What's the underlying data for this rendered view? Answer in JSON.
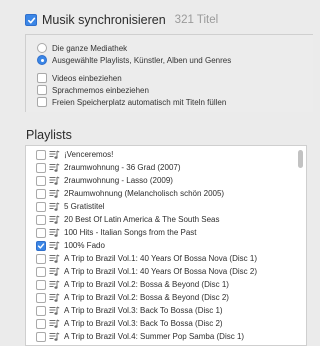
{
  "sync": {
    "label": "Musik synchronisieren",
    "count": "321 Titel",
    "checked": true
  },
  "options": {
    "radio": [
      {
        "label": "Die ganze Mediathek",
        "selected": false
      },
      {
        "label": "Ausgewählte Playlists, Künstler, Alben und Genres",
        "selected": true
      }
    ],
    "checkboxes": [
      {
        "label": "Videos einbeziehen",
        "checked": false
      },
      {
        "label": "Sprachmemos einbeziehen",
        "checked": false
      },
      {
        "label": "Freien Speicherplatz automatisch mit Titeln füllen",
        "checked": false
      }
    ]
  },
  "playlists": {
    "heading": "Playlists",
    "items": [
      {
        "label": "¡Venceremos!",
        "checked": false
      },
      {
        "label": "2raumwohnung - 36 Grad (2007)",
        "checked": false
      },
      {
        "label": "2raumwohnung - Lasso (2009)",
        "checked": false
      },
      {
        "label": "2Raumwohnung (Melancholisch schön 2005)",
        "checked": false
      },
      {
        "label": "5 Gratistitel",
        "checked": false
      },
      {
        "label": "20 Best Of Latin America & The South Seas",
        "checked": false
      },
      {
        "label": "100 Hits - Italian Songs from the Past",
        "checked": false
      },
      {
        "label": "100% Fado",
        "checked": true
      },
      {
        "label": "A Trip to Brazil Vol.1: 40 Years Of Bossa Nova (Disc 1)",
        "checked": false
      },
      {
        "label": "A Trip to Brazil Vol.1: 40 Years Of Bossa Nova (Disc 2)",
        "checked": false
      },
      {
        "label": "A Trip to Brazil Vol.2: Bossa & Beyond (Disc 1)",
        "checked": false
      },
      {
        "label": "A Trip to Brazil Vol.2: Bossa & Beyond (Disc 2)",
        "checked": false
      },
      {
        "label": "A Trip to Brazil Vol.3: Back To Bossa (Disc 1)",
        "checked": false
      },
      {
        "label": "A Trip to Brazil Vol.3: Back To Bossa (Disc 2)",
        "checked": false
      },
      {
        "label": "A Trip to Brazil Vol.4: Summer Pop Samba (Disc 1)",
        "checked": false
      }
    ]
  },
  "colors": {
    "accent": "#3b86e6",
    "background": "#ebebeb",
    "list_background": "#ffffff"
  },
  "icons": {
    "checkmark": "checkmark-icon",
    "playlist": "playlist-icon"
  }
}
